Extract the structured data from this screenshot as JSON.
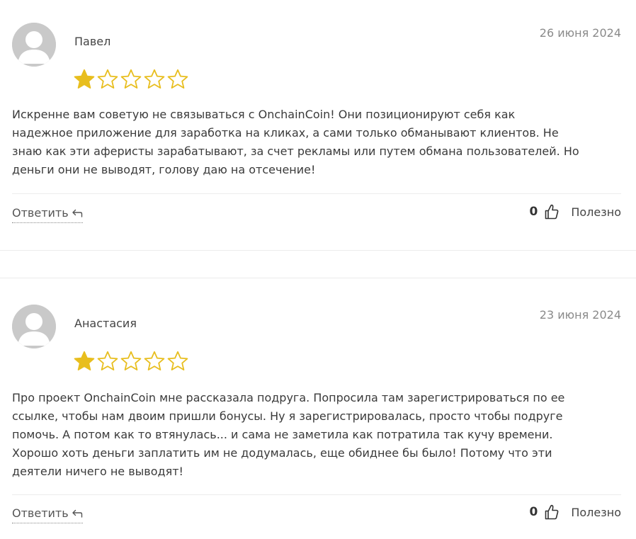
{
  "reviews": [
    {
      "author": "Павел",
      "date": "26 июня 2024",
      "rating": 1,
      "max_rating": 5,
      "text_lines": [
        "Искренне вам советую не связываться с OnchainCoin! Они позиционируют себя как",
        "надежное приложение для заработка на кликах, а сами только обманывают клиентов. Не",
        "знаю как эти аферисты зарабатывают, за счет рекламы или путем обмана пользователей. Но",
        "деньги они не выводят, голову даю на отсечение!"
      ],
      "reply_label": "Ответить",
      "likes": "0",
      "helpful_label": "Полезно"
    },
    {
      "author": "Анастасия",
      "date": "23 июня 2024",
      "rating": 1,
      "max_rating": 5,
      "text_lines": [
        "Про проект OnchainCoin мне рассказала подруга. Попросила там зарегистрироваться по ее",
        "ссылке, чтобы нам двоим пришли бонусы. Ну я зарегистрировалась, просто чтобы подруге",
        "помочь. А потом как то втянулась... и сама не заметила как потратила так кучу времени.",
        "Хорошо хоть деньги заплатить им не додумалась, еще обиднее бы было! Потому что эти",
        "деятели ничего не выводят!"
      ],
      "reply_label": "Ответить",
      "likes": "0",
      "helpful_label": "Полезно"
    }
  ],
  "colors": {
    "star_filled": "#E8BE1E",
    "star_outline": "#E8BE1E",
    "avatar_bg": "#C9C9C9",
    "avatar_fg": "#FFFFFF",
    "divider": "#ECECEC",
    "date": "#8A8A8A"
  },
  "icons": {
    "avatar": "user-silhouette-icon",
    "star": "star-icon",
    "reply": "reply-arrow-icon",
    "like": "thumbs-up-icon"
  }
}
